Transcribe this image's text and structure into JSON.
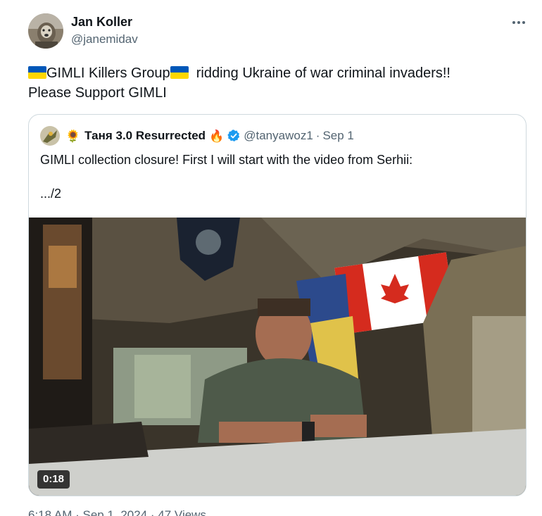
{
  "tweet": {
    "display_name": "Jan Koller",
    "handle": "@janemidav",
    "text_part1": "GIMLI Killers Group",
    "text_part2": "  ridding Ukraine of war criminal invaders!!",
    "text_line2": "Please Support GIMLI",
    "footer": "6:18 AM · Sep 1, 2024 · 47 Views"
  },
  "quote": {
    "emoji_prefix": "🌻",
    "display_name": "Таня 3.0 Resurrected",
    "emoji_suffix": "🔥",
    "handle": "@tanyawoz1",
    "separator": "·",
    "date": "Sep 1",
    "text": "GIMLI collection closure!  First I will start with the video from Serhii:\n\n.../2"
  },
  "video": {
    "duration": "0:18"
  },
  "colors": {
    "text_primary": "#0f1419",
    "text_secondary": "#536471",
    "border": "#cfd9de",
    "verified": "#1d9bf0",
    "ukraine_blue": "#0057b8",
    "ukraine_yellow": "#ffd700"
  },
  "icons": {
    "more": "more-horizontal-icon",
    "verified": "verified-badge-icon",
    "flag": "ukraine-flag-icon"
  }
}
